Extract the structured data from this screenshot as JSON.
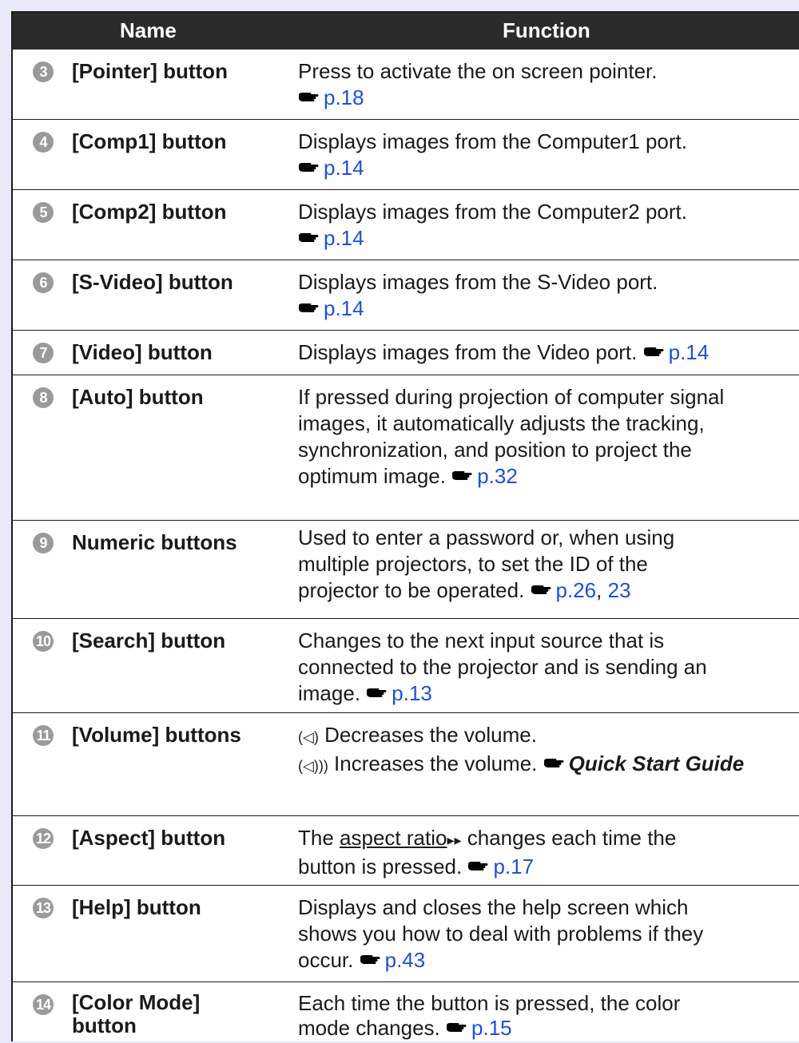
{
  "header": {
    "name": "Name",
    "function": "Function"
  },
  "rows": [
    {
      "num": "3",
      "name": "[Pointer] button",
      "text": "Press to activate the on screen pointer.",
      "link": "p.18"
    },
    {
      "num": "4",
      "name": "[Comp1] button",
      "text": "Displays images from the Computer1 port.",
      "link": "p.14"
    },
    {
      "num": "5",
      "name": "[Comp2] button",
      "text": "Displays images from the Computer2 port.",
      "link": "p.14"
    },
    {
      "num": "6",
      "name": "[S-Video] button",
      "text": "Displays images from the S-Video port.",
      "link": "p.14"
    },
    {
      "num": "7",
      "name": "[Video] button",
      "text": "Displays images from the Video port.",
      "link": "p.14"
    },
    {
      "num": "8",
      "name": "[Auto] button",
      "line1": "If pressed during projection of computer signal",
      "line2": "images, it automatically adjusts the tracking,",
      "line3": "synchronization, and position to project the",
      "line4": "optimum image.",
      "link": "p.32"
    },
    {
      "num": "9",
      "name": "Numeric buttons",
      "line1": "Used to enter a password or, when using",
      "line2": "multiple projectors, to set the ID of the",
      "line3": "projector to be operated.",
      "link": "p.26",
      "sep": ",",
      "link2": "23"
    },
    {
      "num": "10",
      "name": "[Search] button",
      "line1": "Changes to the next input source that is",
      "line2": "connected to the projector and is sending an",
      "line3": "image.",
      "link": "p.13"
    },
    {
      "num": "11",
      "name": "[Volume] buttons",
      "line1_sym": "(◁)",
      "line1": " Decreases the volume.",
      "line2_sym": "(◁)))",
      "line2": " Increases the volume.",
      "guide": "Quick Start Guide"
    },
    {
      "num": "12",
      "name": "[Aspect] button",
      "pre": "The ",
      "term": "aspect ratio",
      "marker": "▸▸",
      "post": " changes each time the",
      "line2": "button is pressed.",
      "link": "p.17"
    },
    {
      "num": "13",
      "name": "[Help] button",
      "line1": "Displays and closes the help screen which",
      "line2": "shows you how to deal with problems if they",
      "line3": "occur.",
      "link": "p.43"
    },
    {
      "num": "14",
      "name1": "[Color Mode]",
      "name2": "button",
      "line1": "Each time the button is pressed, the color",
      "line2": "mode changes.",
      "link": "p.15"
    }
  ],
  "colors": {
    "page_bg": "#e8e8f8",
    "header_bg": "#2b2b2b",
    "number_badge": "#9a9a9a",
    "link": "#1f4fd8"
  },
  "icons": {
    "reference": "pointing-hand-icon"
  }
}
